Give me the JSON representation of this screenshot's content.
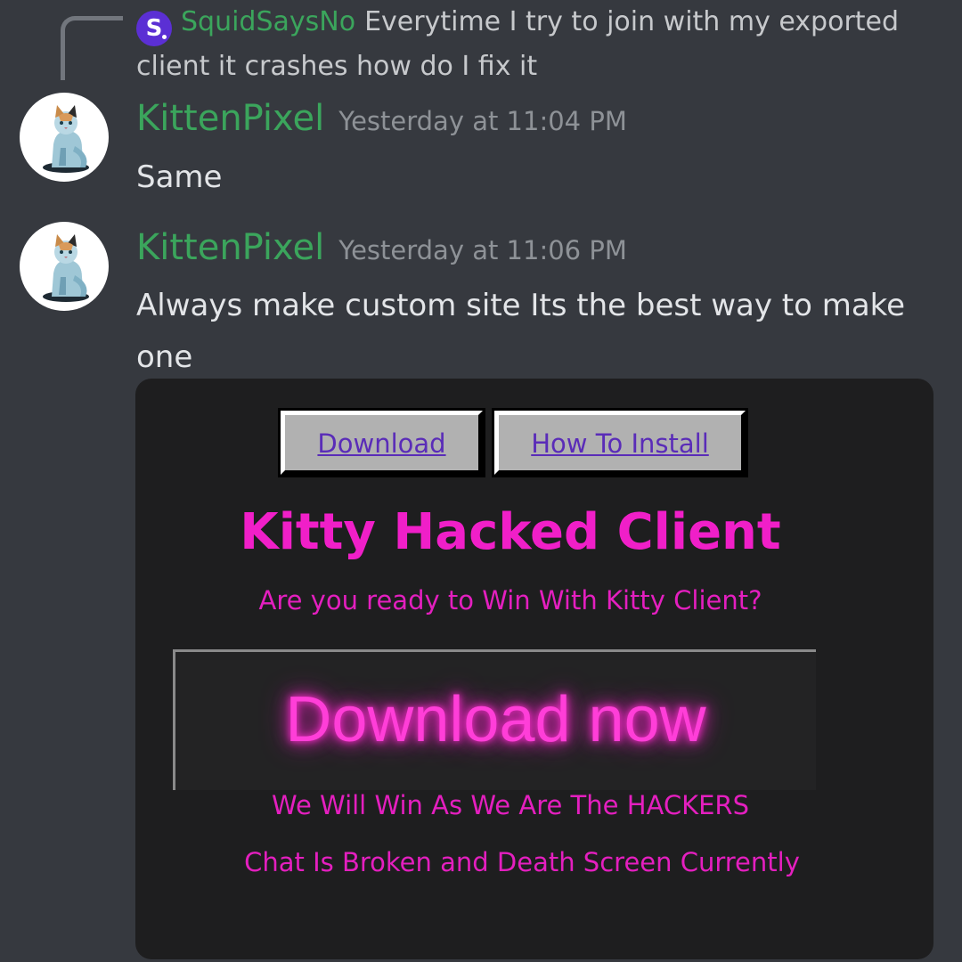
{
  "reply": {
    "avatar_letter": "S",
    "author": "SquidSaysNo",
    "text": "Everytime I try to join with my exported client it crashes how do I fix it"
  },
  "messages": [
    {
      "author": "KittenPixel",
      "timestamp": "Yesterday at 11:04 PM",
      "text": "Same"
    },
    {
      "author": "KittenPixel",
      "timestamp": "Yesterday at 11:06 PM",
      "text": "Always make custom site Its the best way to make one"
    }
  ],
  "embed": {
    "tabs": [
      "Download",
      "How To Install"
    ],
    "title": "Kitty Hacked Client",
    "subtitle": "Are you ready to Win With Kitty Client?",
    "download_now": "Download now",
    "line1": "We Will Win As We Are The HACKERS",
    "line2": "Chat Is Broken and Death Screen Currently"
  },
  "colors": {
    "background": "#36393f",
    "username_green": "#3ba55c",
    "timestamp_gray": "#8e9297",
    "kitty_pink": "#f01fc8",
    "link_purple": "#5a2cb8"
  },
  "icons": {
    "reply_avatar": "squid-avatar-icon",
    "message_avatar": "cat-avatar-icon"
  }
}
